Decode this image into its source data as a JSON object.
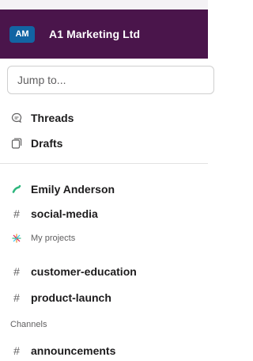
{
  "workspace": {
    "avatar_initials": "AM",
    "name": "A1 Marketing Ltd",
    "header_color": "#4a154b",
    "avatar_color": "#1264a3"
  },
  "search": {
    "placeholder": "Jump to..."
  },
  "nav": {
    "threads": {
      "label": "Threads",
      "icon": "threads-icon"
    },
    "drafts": {
      "label": "Drafts",
      "icon": "drafts-icon"
    }
  },
  "direct_messages": [
    {
      "label": "Emily Anderson",
      "icon": "slack-logo-icon"
    }
  ],
  "starred_channels": [
    {
      "label": "social-media",
      "icon": "hash-icon"
    }
  ],
  "my_projects": {
    "title": "My projects",
    "icon": "sparkle-icon",
    "channels": [
      {
        "label": "customer-education",
        "icon": "hash-icon"
      },
      {
        "label": "product-launch",
        "icon": "hash-icon"
      }
    ]
  },
  "channels": {
    "title": "Channels",
    "items": [
      {
        "label": "announcements",
        "icon": "hash-icon"
      }
    ]
  }
}
